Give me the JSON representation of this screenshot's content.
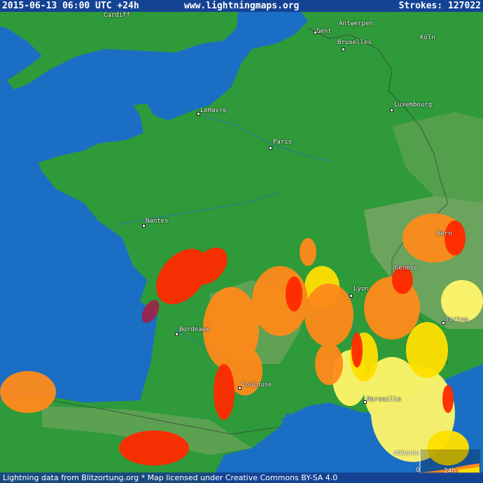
{
  "header": {
    "timestamp": "2015-06-13 06:00 UTC +24h",
    "site": "www.lightningmaps.org",
    "strokes": "Strokes: 127022"
  },
  "footer": {
    "credit": "Lightning data from Blitzortung.org  *  Map licensed under Creative Commons BY-SA 4.0"
  },
  "legend": {
    "rate_label": "400/min",
    "zero_label": "0",
    "window_label": "24h"
  },
  "cities": [
    {
      "id": "gent",
      "name": "Gent"
    },
    {
      "id": "antwerpen",
      "name": "Antwerpen"
    },
    {
      "id": "bruxelles",
      "name": "Bruxelles"
    },
    {
      "id": "koln",
      "name": "Köln"
    },
    {
      "id": "luxembourg",
      "name": "Luxembourg"
    },
    {
      "id": "lehavre",
      "name": "LeHavre"
    },
    {
      "id": "paris",
      "name": "Paris"
    },
    {
      "id": "nantes",
      "name": "Nantes"
    },
    {
      "id": "bern",
      "name": "Bern"
    },
    {
      "id": "geneve",
      "name": "Genève"
    },
    {
      "id": "lyon",
      "name": "Lyon"
    },
    {
      "id": "torino",
      "name": "Torino"
    },
    {
      "id": "bordeaux",
      "name": "Bordeaux"
    },
    {
      "id": "toulouse",
      "name": "Toulouse"
    },
    {
      "id": "marseille",
      "name": "Marseille"
    },
    {
      "id": "cardiff",
      "name": "Cardiff"
    }
  ],
  "colors": {
    "sea": "#1a6fc4",
    "land": "#2e9a3a",
    "highland": "#8aa86a",
    "strike_recent": "#ff2a00",
    "strike_mid": "#ff8a1a",
    "strike_old": "#ffe000",
    "strike_oldest": "#fff56a"
  }
}
